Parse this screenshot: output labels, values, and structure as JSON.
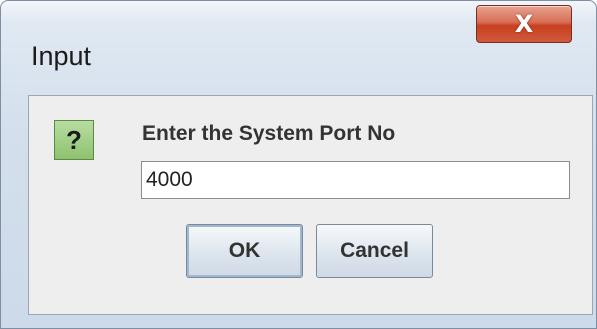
{
  "window": {
    "title": "Input",
    "close_symbol": "X"
  },
  "dialog": {
    "icon": "question-icon",
    "icon_glyph": "?",
    "prompt": "Enter the System Port No",
    "port_value": "4000",
    "ok_label": "OK",
    "cancel_label": "Cancel"
  },
  "colors": {
    "close_button": "#c7401f",
    "icon_background": "#8ec26f",
    "panel_background": "#eeeeee"
  }
}
